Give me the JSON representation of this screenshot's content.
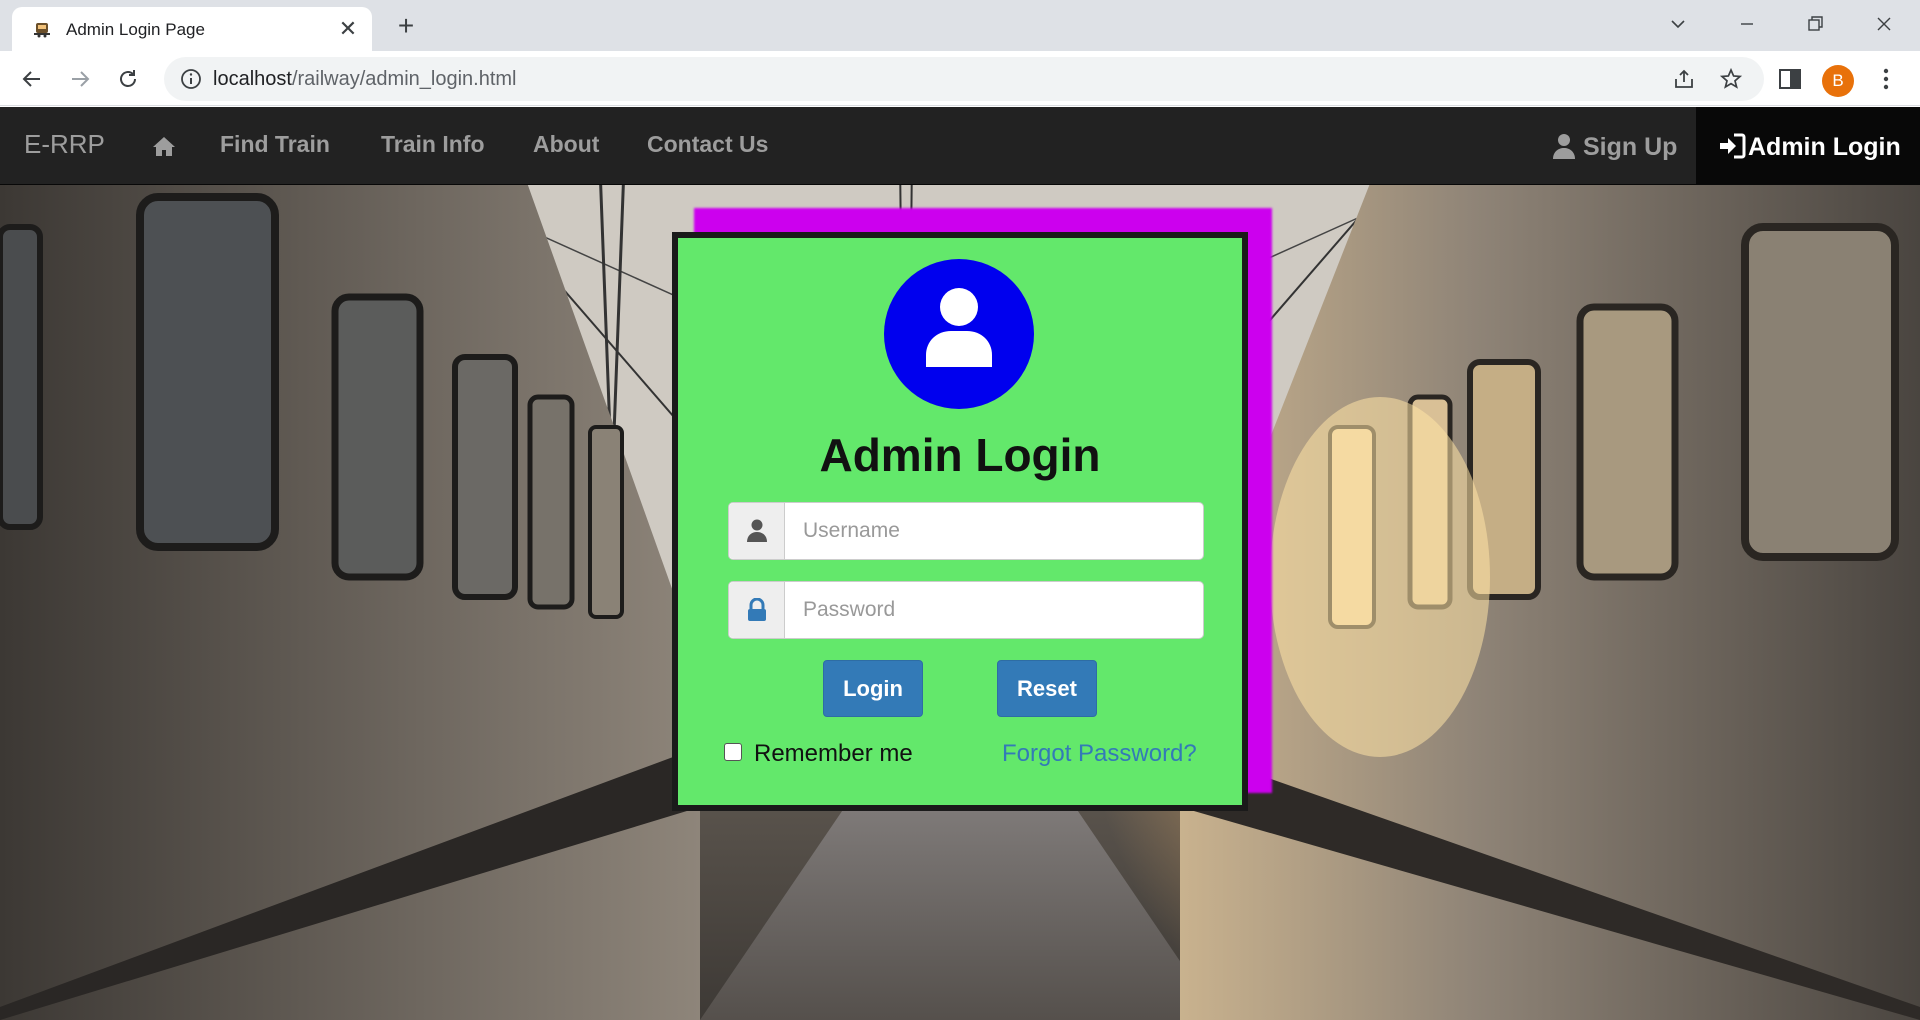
{
  "browser": {
    "tab_title": "Admin Login Page",
    "tab_close_glyph": "✕",
    "new_tab_glyph": "+",
    "url_host": "localhost",
    "url_path": "/railway/admin_login.html",
    "profile_initial": "B",
    "profile_color": "#e8710a"
  },
  "navbar": {
    "brand": "E-RRP",
    "home_icon": "home-icon",
    "links": [
      "Find Train",
      "Train Info",
      "About",
      "Contact Us"
    ],
    "signup_label": "Sign Up",
    "admin_login_label": "Admin Login"
  },
  "login": {
    "heading": "Admin Login",
    "username_placeholder": "Username",
    "username_value": "",
    "password_placeholder": "Password",
    "password_value": "",
    "login_button": "Login",
    "reset_button": "Reset",
    "remember_label": "Remember me",
    "remember_checked": false,
    "forgot_link": "Forgot Password?"
  },
  "colors": {
    "card_bg": "#63e86b",
    "accent_panel": "#cc00ee",
    "avatar_circle": "#0000ee",
    "button": "#337ab7",
    "navbar_bg": "#222222",
    "navbar_active_bg": "#080808"
  }
}
